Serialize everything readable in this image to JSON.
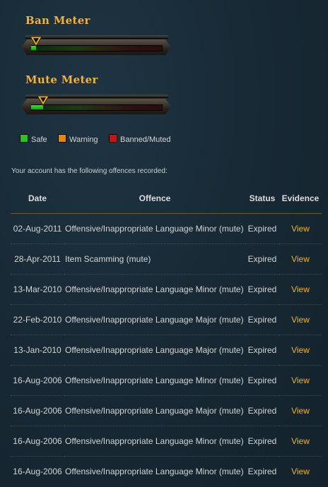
{
  "ban_meter": {
    "title": "Ban Meter",
    "level_percent": 4
  },
  "mute_meter": {
    "title": "Mute Meter",
    "level_percent": 9
  },
  "legend": [
    {
      "label": "Safe",
      "color": "#2ec21e"
    },
    {
      "label": "Warning",
      "color": "#e08a12"
    },
    {
      "label": "Banned/Muted",
      "color": "#c41414"
    }
  ],
  "intro_text": "Your account has the following offences recorded:",
  "table": {
    "headers": {
      "date": "Date",
      "offence": "Offence",
      "status": "Status",
      "evidence": "Evidence"
    },
    "rows": [
      {
        "date": "02-Aug-2011",
        "offence": "Offensive/Inappropriate Language Minor (mute)",
        "status": "Expired",
        "evidence": "View"
      },
      {
        "date": "28-Apr-2011",
        "offence": "Item Scamming (mute)",
        "status": "Expired",
        "evidence": "View"
      },
      {
        "date": "13-Mar-2010",
        "offence": "Offensive/Inappropriate Language Minor (mute)",
        "status": "Expired",
        "evidence": "View"
      },
      {
        "date": "22-Feb-2010",
        "offence": "Offensive/Inappropriate Language Major (mute)",
        "status": "Expired",
        "evidence": "View"
      },
      {
        "date": "13-Jan-2010",
        "offence": "Offensive/Inappropriate Language Major (mute)",
        "status": "Expired",
        "evidence": "View"
      },
      {
        "date": "16-Aug-2006",
        "offence": "Offensive/Inappropriate Language Minor (mute)",
        "status": "Expired",
        "evidence": "View"
      },
      {
        "date": "16-Aug-2006",
        "offence": "Offensive/Inappropriate Language Major (mute)",
        "status": "Expired",
        "evidence": "View"
      },
      {
        "date": "16-Aug-2006",
        "offence": "Offensive/Inappropriate Language Minor (mute)",
        "status": "Expired",
        "evidence": "View"
      },
      {
        "date": "16-Aug-2006",
        "offence": "Offensive/Inappropriate Language Minor (mute)",
        "status": "Expired",
        "evidence": "View"
      }
    ]
  }
}
